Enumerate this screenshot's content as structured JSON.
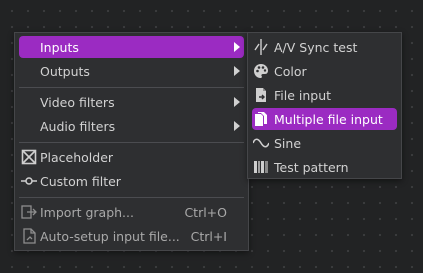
{
  "main_menu": {
    "items": [
      {
        "label": "Inputs",
        "has_submenu": true,
        "active": true
      },
      {
        "label": "Outputs",
        "has_submenu": true
      },
      {
        "label": "Video filters",
        "has_submenu": true
      },
      {
        "label": "Audio filters",
        "has_submenu": true
      },
      {
        "label": "Placeholder",
        "icon": "placeholder-box-icon"
      },
      {
        "label": "Custom filter",
        "icon": "custom-filter-icon"
      },
      {
        "label": "Import graph...",
        "shortcut": "Ctrl+O",
        "icon": "import-graph-icon",
        "disabled": true
      },
      {
        "label": "Auto-setup input file...",
        "shortcut": "Ctrl+I",
        "icon": "auto-setup-file-icon",
        "disabled": true
      }
    ]
  },
  "sub_menu": {
    "items": [
      {
        "label": "A/V Sync test",
        "icon": "av-sync-icon"
      },
      {
        "label": "Color",
        "icon": "palette-icon"
      },
      {
        "label": "File input",
        "icon": "file-input-icon"
      },
      {
        "label": "Multiple file input",
        "icon": "multiple-files-icon",
        "active": true
      },
      {
        "label": "Sine",
        "icon": "sine-wave-icon"
      },
      {
        "label": "Test pattern",
        "icon": "test-pattern-icon"
      }
    ]
  },
  "colors": {
    "background": "#222324",
    "menu_bg": "#2e2f31",
    "accent": "#9b2bc2",
    "text": "#d2d2d2"
  }
}
